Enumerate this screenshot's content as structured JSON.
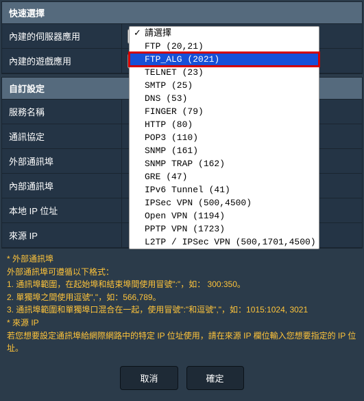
{
  "quick_section_title": "快速選擇",
  "server_app_label": "內建的伺服器應用",
  "game_app_label": "內建的遊戲應用",
  "custom_section_title": "自訂設定",
  "fields": {
    "service_name": "服務名稱",
    "protocol": "通訊協定",
    "ext_port": "外部通訊埠",
    "int_port": "內部通訊埠",
    "local_ip": "本地 IP 位址",
    "source_ip": "來源 IP"
  },
  "dropdown": {
    "checked": "請選擇",
    "options": [
      "請選擇",
      "FTP (20,21)",
      "FTP_ALG (2021)",
      "TELNET (23)",
      "SMTP (25)",
      "DNS (53)",
      "FINGER (79)",
      "HTTP (80)",
      "POP3 (110)",
      "SNMP (161)",
      "SNMP TRAP (162)",
      "GRE (47)",
      "IPv6 Tunnel (41)",
      "IPSec VPN (500,4500)",
      "Open VPN (1194)",
      "PPTP VPN (1723)",
      "L2TP / IPSec VPN (500,1701,4500)"
    ],
    "highlighted": "FTP_ALG (2021)"
  },
  "help": {
    "h1": "* 外部通訊埠",
    "l1": "外部通訊埠可遵循以下格式：",
    "l2": "1. 通訊埠範圍，在起始埠和結束埠間使用冒號\":\"，如： 300:350。",
    "l3": "2. 單獨埠之間使用逗號\",\"，如：566,789。",
    "l4": "3. 通訊埠範圍和單獨埠口混合在一起，使用冒號\":\"和逗號\",\"，如：1015:1024, 3021",
    "h2": "* 來源 IP",
    "l5": "若您想要設定通訊埠給網際網路中的特定 IP 位址使用，請在來源 IP 欄位輸入您想要指定的 IP 位址。"
  },
  "buttons": {
    "cancel": "取消",
    "ok": "確定"
  }
}
